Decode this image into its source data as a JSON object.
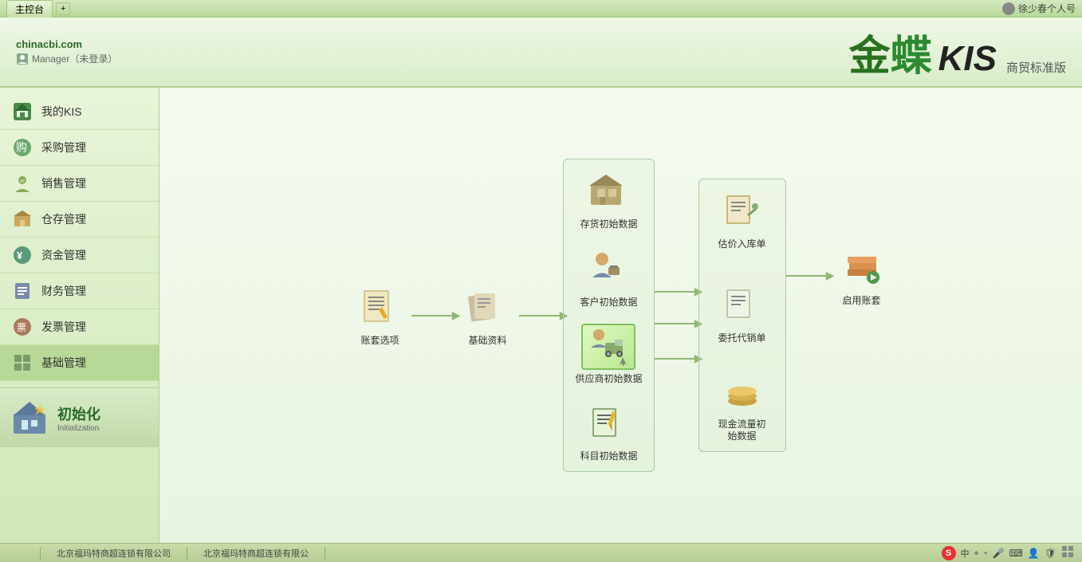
{
  "topbar": {
    "tab_main": "主控台",
    "add_tab": "+",
    "user": "徐少春个人号"
  },
  "header": {
    "site": "chinacbi.com",
    "manager": "Manager（未登录）",
    "logo_jin": "金",
    "logo_die": "蝶",
    "logo_kis": "KIS",
    "logo_sub": "商贸标准版"
  },
  "sidebar": {
    "items": [
      {
        "id": "my-kis",
        "label": "我的KIS",
        "icon": "home"
      },
      {
        "id": "purchase",
        "label": "采购管理",
        "icon": "cart"
      },
      {
        "id": "sales",
        "label": "销售管理",
        "icon": "person-tie"
      },
      {
        "id": "warehouse",
        "label": "仓存管理",
        "icon": "box"
      },
      {
        "id": "finance",
        "label": "资金管理",
        "icon": "coin"
      },
      {
        "id": "accounting",
        "label": "财务管理",
        "icon": "ledger"
      },
      {
        "id": "invoice",
        "label": "发票管理",
        "icon": "invoice"
      },
      {
        "id": "basic",
        "label": "基础管理",
        "icon": "grid"
      },
      {
        "id": "init",
        "label": "初始化",
        "sub": "Initialization"
      }
    ]
  },
  "flow": {
    "node_zhangao": "账套选项",
    "node_jichu": "基础资料",
    "node_cunkuo": "存货初始数据",
    "node_kehu": "客户初始数据",
    "node_gongyinshang": "供应商初始数据",
    "node_kemu": "科目初始数据",
    "node_gujia": "估价入库单",
    "node_weituo": "委托代销单",
    "node_xianjin": "现金流量初始数据",
    "node_qiyong": "启用账套"
  },
  "statusbar": {
    "left": "",
    "center1": "北京福玛特商超连锁有限公司",
    "center2": "北京福玛特商超连锁有限公",
    "right_icons": [
      "中",
      "♦",
      "●",
      "🎤",
      "⌨",
      "👤",
      "🛡",
      "⚙"
    ]
  }
}
